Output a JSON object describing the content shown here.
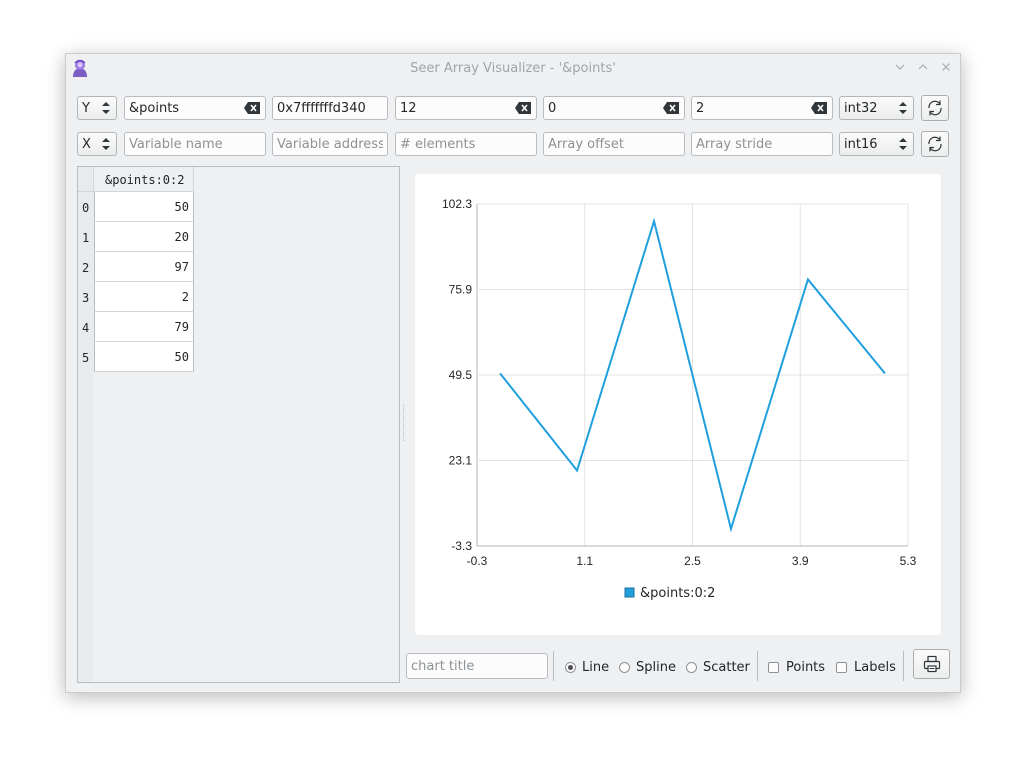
{
  "window": {
    "title": "Seer Array Visualizer - '&points'"
  },
  "y_row": {
    "axis": "Y",
    "variable": "&points",
    "address": "0x7fffffffd340",
    "elements": "12",
    "offset": "0",
    "stride": "2",
    "type": "int32"
  },
  "x_row": {
    "axis": "X",
    "variable_placeholder": "Variable name",
    "address_placeholder": "Variable address",
    "elements_placeholder": "# elements",
    "offset_placeholder": "Array offset",
    "stride_placeholder": "Array stride",
    "type": "int16"
  },
  "table": {
    "column": "&points:0:2",
    "rows": [
      {
        "index": "0",
        "value": "50"
      },
      {
        "index": "1",
        "value": "20"
      },
      {
        "index": "2",
        "value": "97"
      },
      {
        "index": "3",
        "value": "2"
      },
      {
        "index": "4",
        "value": "79"
      },
      {
        "index": "5",
        "value": "50"
      }
    ]
  },
  "chart_data": {
    "type": "line",
    "x": [
      0,
      1,
      2,
      3,
      4,
      5
    ],
    "series": [
      {
        "name": "&points:0:2",
        "values": [
          50,
          20,
          97,
          2,
          79,
          50
        ],
        "color": "#209fdf"
      }
    ],
    "x_ticks": [
      "-0.3",
      "1.1",
      "2.5",
      "3.9",
      "5.3"
    ],
    "y_ticks": [
      "102.3",
      "75.9",
      "49.5",
      "23.1",
      "-3.3"
    ],
    "xlim": [
      -0.3,
      5.3
    ],
    "ylim": [
      -3.3,
      102.3
    ],
    "grid": true,
    "legend": "bottom"
  },
  "controls": {
    "chart_title_placeholder": "chart title",
    "line_label": "Line",
    "spline_label": "Spline",
    "scatter_label": "Scatter",
    "points_label": "Points",
    "labels_label": "Labels",
    "selected": "Line"
  },
  "colors": {
    "line": "#209fdf",
    "grid": "#e3e3e3",
    "axis": "#b5b5b5"
  }
}
